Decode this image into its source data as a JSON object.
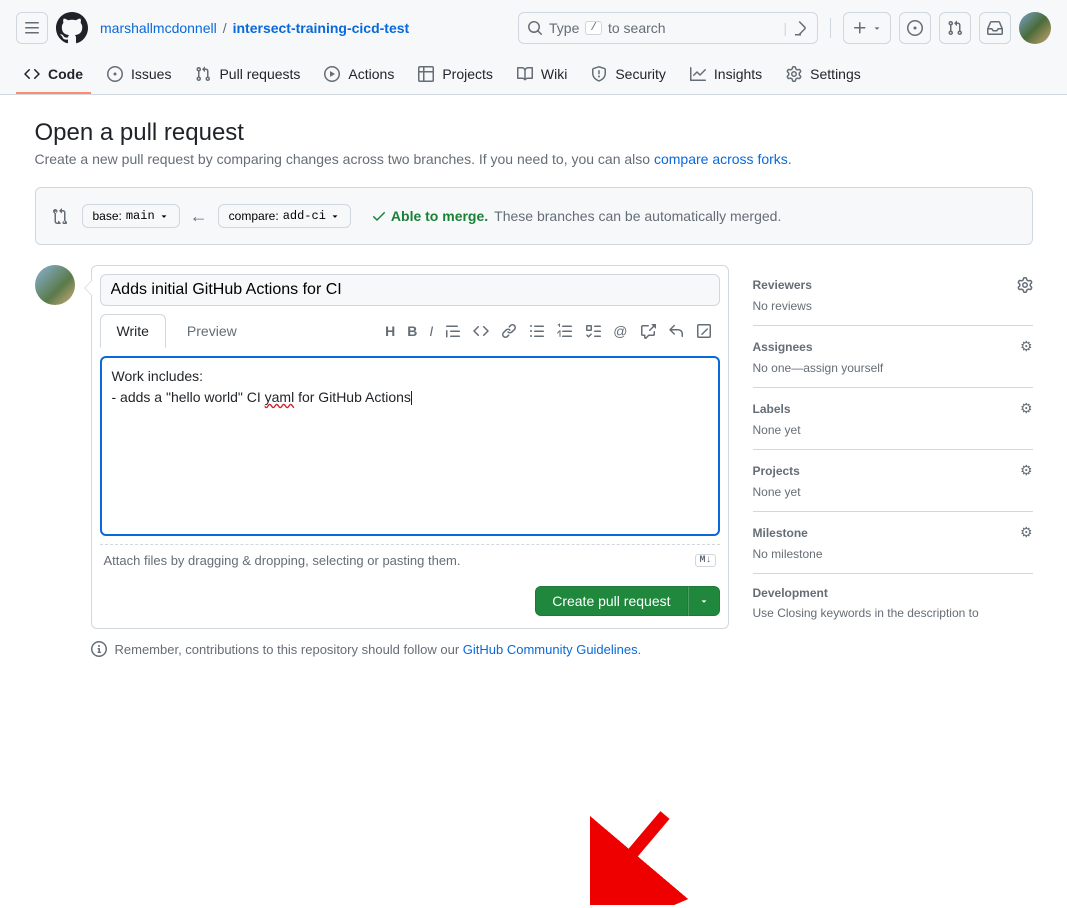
{
  "header": {
    "owner": "marshallmcdonnell",
    "repo": "intersect-training-cicd-test",
    "search_placeholder_pre": "Type",
    "search_key": "/",
    "search_placeholder_post": "to search"
  },
  "nav": {
    "code": "Code",
    "issues": "Issues",
    "pulls": "Pull requests",
    "actions": "Actions",
    "projects": "Projects",
    "wiki": "Wiki",
    "security": "Security",
    "insights": "Insights",
    "settings": "Settings"
  },
  "page": {
    "title": "Open a pull request",
    "subtitle_pre": "Create a new pull request by comparing changes across two branches. If you need to, you can also ",
    "subtitle_link": "compare across forks",
    "subtitle_post": "."
  },
  "compare": {
    "base_label": "base: ",
    "base_branch": "main",
    "compare_label": "compare: ",
    "compare_branch": "add-ci",
    "able": "Able to merge.",
    "able_desc": "These branches can be automatically merged."
  },
  "composer": {
    "title_value": "Adds initial GitHub Actions for CI",
    "write": "Write",
    "preview": "Preview",
    "body_line1": "Work includes:",
    "body_line2_pre": " - adds a \"hello world\" CI ",
    "body_line2_err": "yaml",
    "body_line2_post": " for GitHub Actions",
    "attach_hint": "Attach files by dragging & dropping, selecting or pasting them.",
    "md_badge": "M↓",
    "create_btn": "Create pull request"
  },
  "contrib": {
    "pre": "Remember, contributions to this repository should follow our ",
    "link": "GitHub Community Guidelines",
    "post": "."
  },
  "sidebar": {
    "reviewers": {
      "title": "Reviewers",
      "val": "No reviews"
    },
    "assignees": {
      "title": "Assignees",
      "val_pre": "No one—",
      "val_link": "assign yourself"
    },
    "labels": {
      "title": "Labels",
      "val": "None yet"
    },
    "projects": {
      "title": "Projects",
      "val": "None yet"
    },
    "milestone": {
      "title": "Milestone",
      "val": "No milestone"
    },
    "development": {
      "title": "Development",
      "val_pre": "Use ",
      "val_link": "Closing keywords",
      "val_post": " in the description to"
    }
  }
}
